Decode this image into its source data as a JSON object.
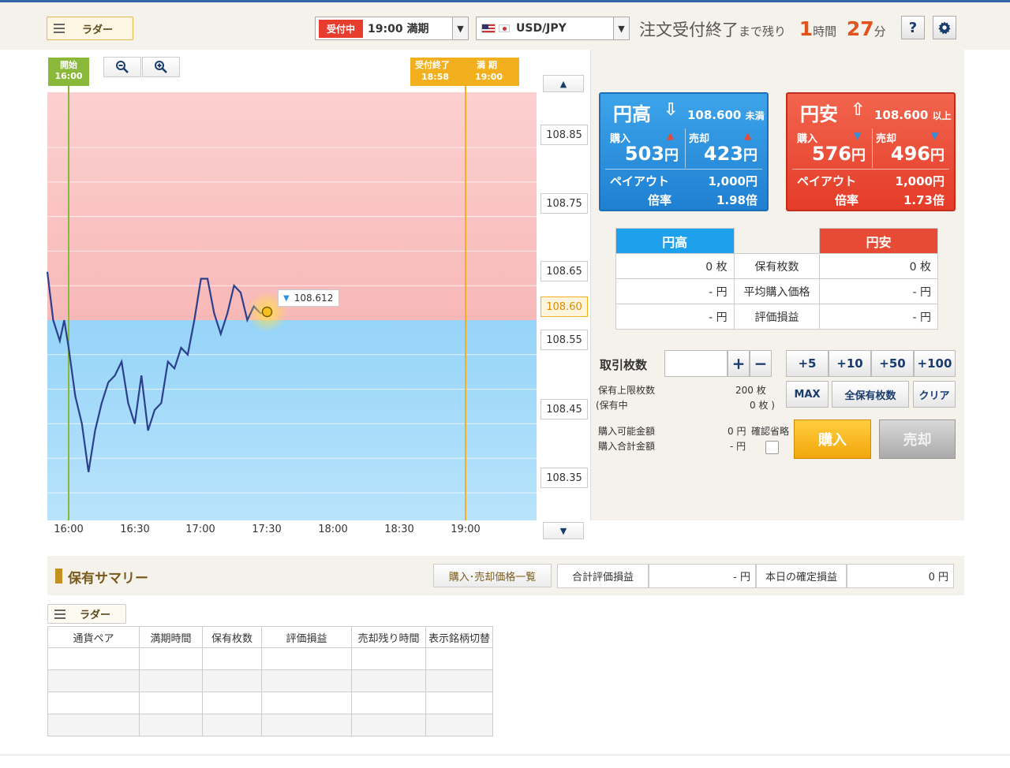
{
  "header": {
    "ladder_label": "ラダー",
    "status_badge": "受付中",
    "expiry_select": "19:00 満期",
    "currency_select": "USD/JPY",
    "countdown_prefix": "注文受付終了",
    "countdown_mid": "まで残り",
    "countdown_hours": "1",
    "countdown_hours_unit": "時間",
    "countdown_minutes": "27",
    "countdown_minutes_unit": "分",
    "help_label": "?"
  },
  "chart": {
    "start_label": "開始",
    "start_time": "16:00",
    "end_label": "受付終了",
    "end_time": "18:58",
    "expiry_label": "満 期",
    "expiry_time": "19:00",
    "current_price": "108.612",
    "target_price": "108.60",
    "y_ticks": [
      "108.85",
      "108.75",
      "108.65",
      "108.55",
      "108.45",
      "108.35"
    ],
    "x_ticks": [
      "16:00",
      "16:30",
      "17:00",
      "17:30",
      "18:00",
      "18:30",
      "19:00"
    ]
  },
  "chart_data": {
    "type": "line",
    "y_range": [
      108.31,
      108.93
    ],
    "x_range": [
      "16:00",
      "19:44"
    ],
    "strike": 108.6,
    "series": [
      {
        "x": [
          "15:50",
          "15:53",
          "15:56",
          "15:58",
          "16:00",
          "16:03",
          "16:06",
          "16:09",
          "16:12",
          "16:15",
          "16:18",
          "16:21",
          "16:24",
          "16:27",
          "16:30",
          "16:33",
          "16:36",
          "16:39",
          "16:42",
          "16:45",
          "16:48",
          "16:51",
          "16:54",
          "16:57",
          "17:00",
          "17:03",
          "17:06",
          "17:09",
          "17:12",
          "17:15",
          "17:18",
          "17:21",
          "17:24",
          "17:27",
          "17:30"
        ],
        "y": [
          108.67,
          108.6,
          108.57,
          108.6,
          108.56,
          108.49,
          108.45,
          108.38,
          108.44,
          108.48,
          108.51,
          108.52,
          108.54,
          108.48,
          108.45,
          108.52,
          108.44,
          108.47,
          108.48,
          108.54,
          108.53,
          108.56,
          108.55,
          108.6,
          108.66,
          108.66,
          108.61,
          108.58,
          108.61,
          108.65,
          108.64,
          108.6,
          108.62,
          108.61,
          108.612
        ]
      }
    ]
  },
  "cards": {
    "high": {
      "title": "円高",
      "threshold": "108.600",
      "threshold_unit": "未満",
      "buy_label": "購入",
      "sell_label": "売却",
      "buy_price": "503",
      "sell_price": "423",
      "yen": "円",
      "payout_label": "ペイアウト",
      "payout": "1,000円",
      "rate_label": "倍率",
      "rate": "1.98倍"
    },
    "low": {
      "title": "円安",
      "threshold": "108.600",
      "threshold_unit": "以上",
      "buy_label": "購入",
      "sell_label": "売却",
      "buy_price": "576",
      "sell_price": "496",
      "yen": "円",
      "payout_label": "ペイアウト",
      "payout": "1,000円",
      "rate_label": "倍率",
      "rate": "1.73倍"
    }
  },
  "holdings": {
    "high_header": "円高",
    "low_header": "円安",
    "rows": [
      {
        "label": "保有枚数",
        "high": "0 枚",
        "low": "0 枚"
      },
      {
        "label": "平均購入価格",
        "high": "- 円",
        "low": "- 円"
      },
      {
        "label": "評価損益",
        "high": "- 円",
        "low": "- 円"
      }
    ]
  },
  "order": {
    "qty_label": "取引枚数",
    "qty_value": "",
    "plus": "+",
    "minus": "−",
    "quick": [
      "+5",
      "+10",
      "+50",
      "+100"
    ],
    "max": "MAX",
    "all_held": "全保有枚数",
    "clear": "クリア",
    "limit_label": "保有上限枚数",
    "limit_value": "200 枚",
    "held_label": "(保有中",
    "held_value": "0 枚 )",
    "avail_label": "購入可能金額",
    "avail_value": "0 円",
    "total_label": "購入合計金額",
    "total_value": "- 円",
    "skip_confirm": "確認省略",
    "buy_button": "購入",
    "sell_button": "売却"
  },
  "summary": {
    "title": "保有サマリー",
    "price_list_button": "購入･売却価格一覧",
    "total_pl_label": "合計評価損益",
    "total_pl_value": "- 円",
    "today_pl_label": "本日の確定損益",
    "today_pl_value": "0 円",
    "ladder_label": "ラダー",
    "columns": [
      "通貨ペア",
      "満期時間",
      "保有枚数",
      "評価損益",
      "売却残り時間",
      "表示銘柄切替"
    ]
  },
  "colors": {
    "high": "#2f8fdc",
    "low": "#e74b36",
    "accent": "#f2b01e"
  }
}
